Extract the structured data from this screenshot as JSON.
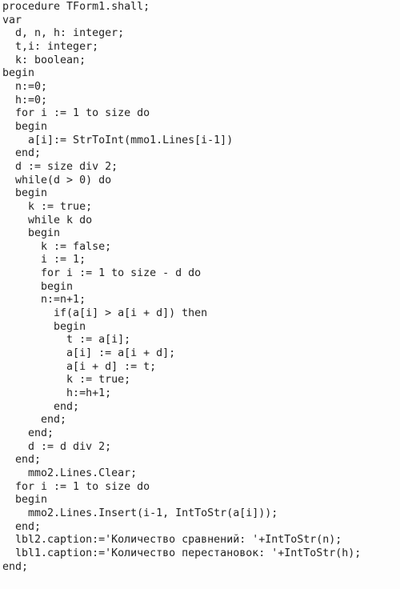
{
  "document": {
    "kind": "source-code-listing",
    "language": "Pascal",
    "background_color": "#fdfdfd",
    "text_color": "#232323",
    "lines": [
      "procedure TForm1.shall;",
      "var",
      "  d, n, h: integer;",
      "  t,i: integer;",
      "  k: boolean;",
      "begin",
      "  n:=0;",
      "  h:=0;",
      "  for i := 1 to size do",
      "  begin",
      "    a[i]:= StrToInt(mmo1.Lines[i-1])",
      "  end;",
      "  d := size div 2;",
      "  while(d > 0) do",
      "  begin",
      "    k := true;",
      "    while k do",
      "    begin",
      "      k := false;",
      "      i := 1;",
      "      for i := 1 to size - d do",
      "      begin",
      "      n:=n+1;",
      "        if(a[i] > a[i + d]) then",
      "        begin",
      "          t := a[i];",
      "          a[i] := a[i + d];",
      "          a[i + d] := t;",
      "          k := true;",
      "          h:=h+1;",
      "        end;",
      "      end;",
      "    end;",
      "    d := d div 2;",
      "  end;",
      "    mmo2.Lines.Clear;",
      "  for i := 1 to size do",
      "  begin",
      "    mmo2.Lines.Insert(i-1, IntToStr(a[i]));",
      "  end;",
      "  lbl2.caption:='Количество сравнений: '+IntToStr(n);",
      "  lbl1.caption:='Количество перестановок: '+IntToStr(h);",
      "end;"
    ]
  }
}
